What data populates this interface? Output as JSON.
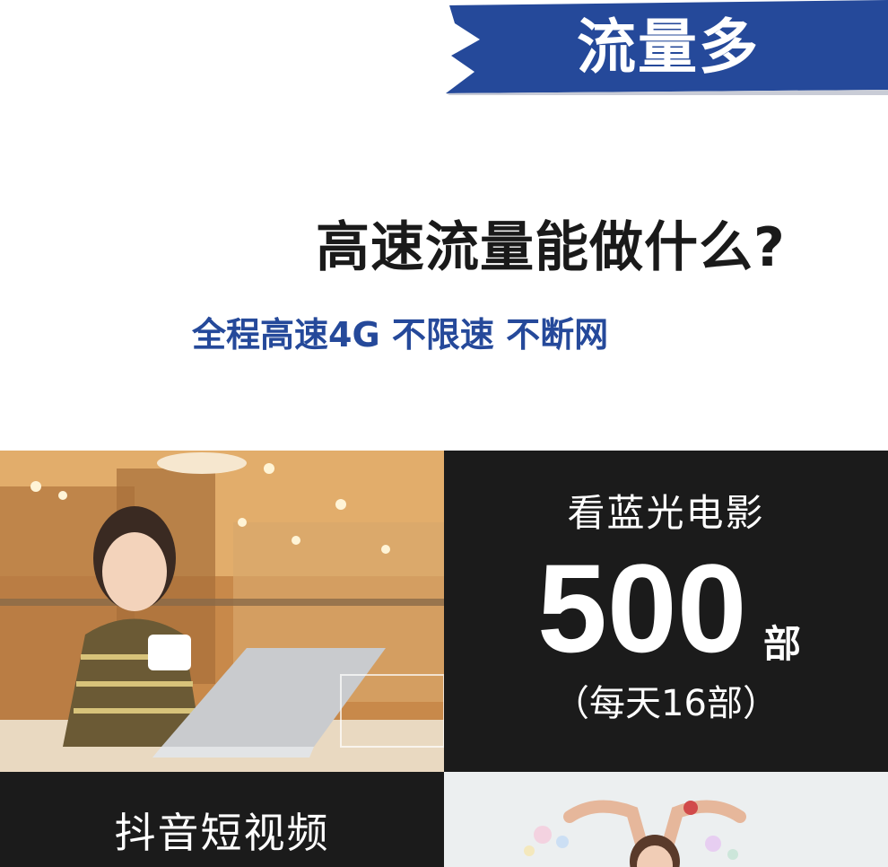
{
  "banner": {
    "text": "流量多",
    "color": "#25499a"
  },
  "headline": "高速流量能做什么?",
  "subline": "全程高速4G 不限速 不断网",
  "movies": {
    "label": "看蓝光电影",
    "count": "500",
    "unit": "部",
    "note": "（每天16部）"
  },
  "douyin": {
    "label": "抖音短视频"
  },
  "colors": {
    "accent": "#25499a",
    "panel": "#1b1b1b",
    "text_dark": "#1a1a1a"
  }
}
